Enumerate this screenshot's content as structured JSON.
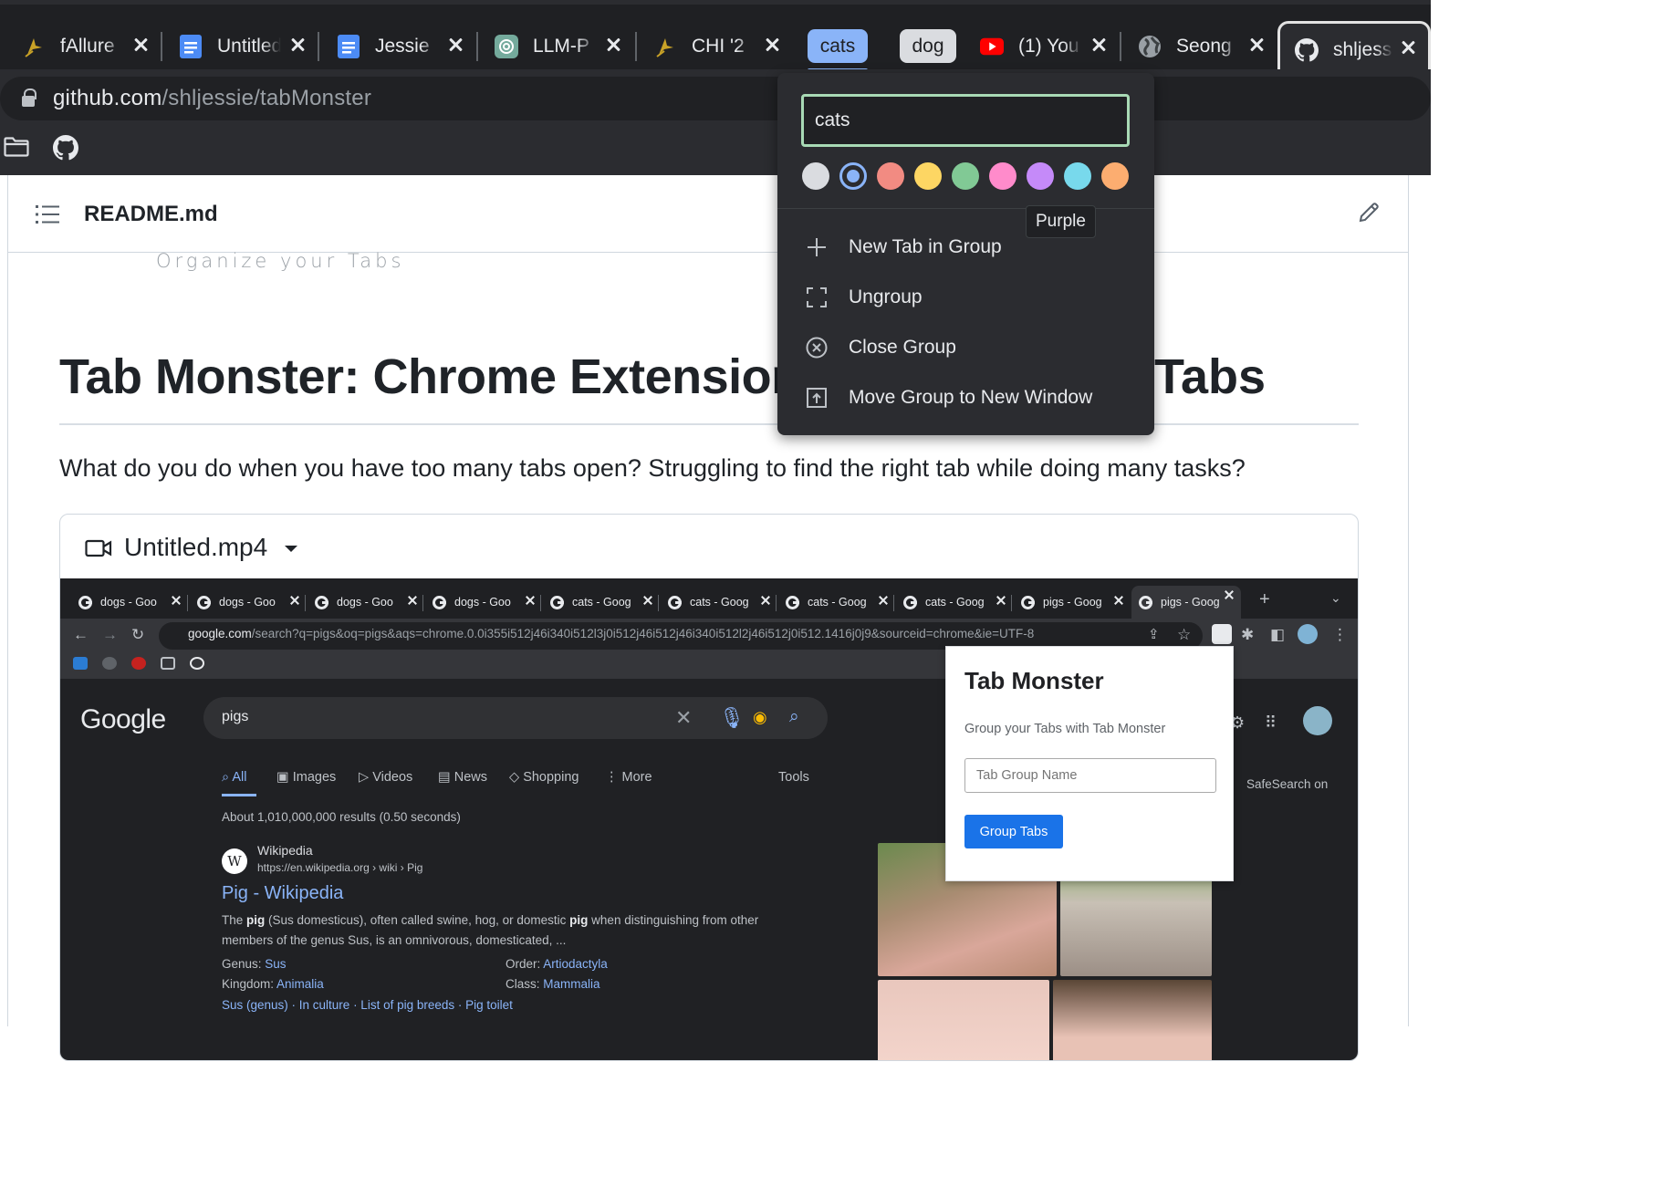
{
  "tabs": [
    {
      "title": "fAllure",
      "icon": "chi-icon"
    },
    {
      "title": "Untitled",
      "icon": "docs-icon"
    },
    {
      "title": "Jessie",
      "icon": "docs-icon"
    },
    {
      "title": "LLM-P",
      "icon": "openai-icon"
    },
    {
      "title": "CHI '2",
      "icon": "chi-icon"
    },
    {
      "title": "(1) You",
      "icon": "youtube-icon"
    },
    {
      "title": "Seong",
      "icon": "globe-icon"
    },
    {
      "title": "shljess",
      "icon": "github-icon"
    }
  ],
  "tab_groups": [
    {
      "name": "cats",
      "color": "#8ab4f8"
    },
    {
      "name": "dog",
      "color": "#dadce0"
    }
  ],
  "address_bar": {
    "host": "github.com",
    "path": "/shljessie/tabMonster"
  },
  "bookmarks": [
    "folder-icon",
    "github-icon"
  ],
  "group_menu": {
    "name_value": "cats",
    "colors": [
      {
        "name": "Grey",
        "hex": "#dadce0"
      },
      {
        "name": "Blue",
        "hex": "#8ab4f8",
        "selected": true
      },
      {
        "name": "Red",
        "hex": "#f28b82"
      },
      {
        "name": "Yellow",
        "hex": "#fdd663"
      },
      {
        "name": "Green",
        "hex": "#81c995"
      },
      {
        "name": "Pink",
        "hex": "#ff8bcb"
      },
      {
        "name": "Purple",
        "hex": "#c58af9"
      },
      {
        "name": "Cyan",
        "hex": "#78d9ec"
      },
      {
        "name": "Orange",
        "hex": "#fcad70"
      }
    ],
    "tooltip": "Purple",
    "items": [
      {
        "label": "New Tab in Group",
        "icon": "plus-icon"
      },
      {
        "label": "Ungroup",
        "icon": "ungroup-icon"
      },
      {
        "label": "Close Group",
        "icon": "close-circle-icon"
      },
      {
        "label": "Move Group to New Window",
        "icon": "move-window-icon"
      }
    ]
  },
  "readme": {
    "filename": "README.md",
    "tagline": "Organize your Tabs",
    "heading_left": "Tab Monster: Chrome Extension",
    "heading_right": "Tabs",
    "paragraph": "What do you do when you have too many tabs open? Struggling to find the right tab while doing many tasks?",
    "video_name": "Untitled.mp4"
  },
  "embedded": {
    "tabs": [
      "dogs - Goo",
      "dogs - Goo",
      "dogs - Goo",
      "dogs - Goo",
      "cats - Goog",
      "cats - Goog",
      "cats - Goog",
      "cats - Goog",
      "pigs - Goog",
      "pigs - Goog"
    ],
    "url_host": "google.com",
    "url_path": "/search?q=pigs&oq=pigs&aqs=chrome.0.0i355i512j46i340i512l3j0i512j46i512j46i340i512l2j46i512j0i512.1416j0j9&sourceid=chrome&ie=UTF-8",
    "google_logo": "Google",
    "query": "pigs",
    "filters": [
      "All",
      "Images",
      "Videos",
      "News",
      "Shopping",
      "More",
      "Tools"
    ],
    "results_count": "About 1,010,000,000 results (0.50 seconds)",
    "wiki": {
      "site": "Wikipedia",
      "url": "https://en.wikipedia.org › wiki › Pig",
      "title": "Pig - Wikipedia",
      "snippet_pre": "The ",
      "snippet_b1": "pig",
      "snippet_mid": " (Sus domesticus), often called swine, hog, or domestic ",
      "snippet_b2": "pig",
      "snippet_post": " when distinguishing from other members of the genus Sus, is an omnivorous, domesticated, ...",
      "genus_label": "Genus: ",
      "genus": "Sus",
      "kingdom_label": "Kingdom: ",
      "kingdom": "Animalia",
      "order_label": "Order: ",
      "order": "Artiodactyla",
      "class_label": "Class: ",
      "class": "Mammalia",
      "links": "Sus (genus) · In culture · List of pig breeds · Pig toilet"
    },
    "safesearch": "SafeSearch on",
    "popup": {
      "title": "Tab Monster",
      "subtitle": "Group your Tabs with Tab Monster",
      "placeholder": "Tab Group Name",
      "button": "Group Tabs"
    }
  }
}
